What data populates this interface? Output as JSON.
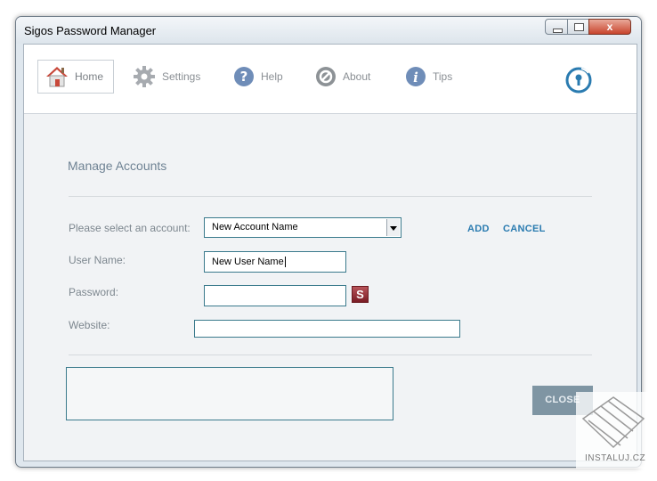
{
  "window": {
    "title": "Sigos Password Manager",
    "close_glyph": "x"
  },
  "nav": {
    "items": [
      {
        "label": "Home",
        "icon": "house-icon"
      },
      {
        "label": "Settings",
        "icon": "gear-icon"
      },
      {
        "label": "Help",
        "icon": "question-icon"
      },
      {
        "label": "About",
        "icon": "about-icon"
      },
      {
        "label": "Tips",
        "icon": "info-icon"
      }
    ],
    "logo_icon": "keyhole-lock-icon"
  },
  "form": {
    "section_title": "Manage Accounts",
    "account_label": "Please select an account:",
    "account_selected": "New Account Name",
    "username_label": "User Name:",
    "username_value": "New User Name",
    "password_label": "Password:",
    "password_value": "",
    "website_label": "Website:",
    "website_value": "",
    "generate_button": "S",
    "add_label": "ADD",
    "cancel_label": "CANCEL",
    "close_label": "CLOSE"
  },
  "watermark": {
    "text": "INSTALUJ.CZ"
  },
  "colors": {
    "accent_blue": "#2a7bb0",
    "field_border": "#3a7a8c",
    "close_button": "#7f95a3",
    "generate_button": "#8a2a32"
  }
}
